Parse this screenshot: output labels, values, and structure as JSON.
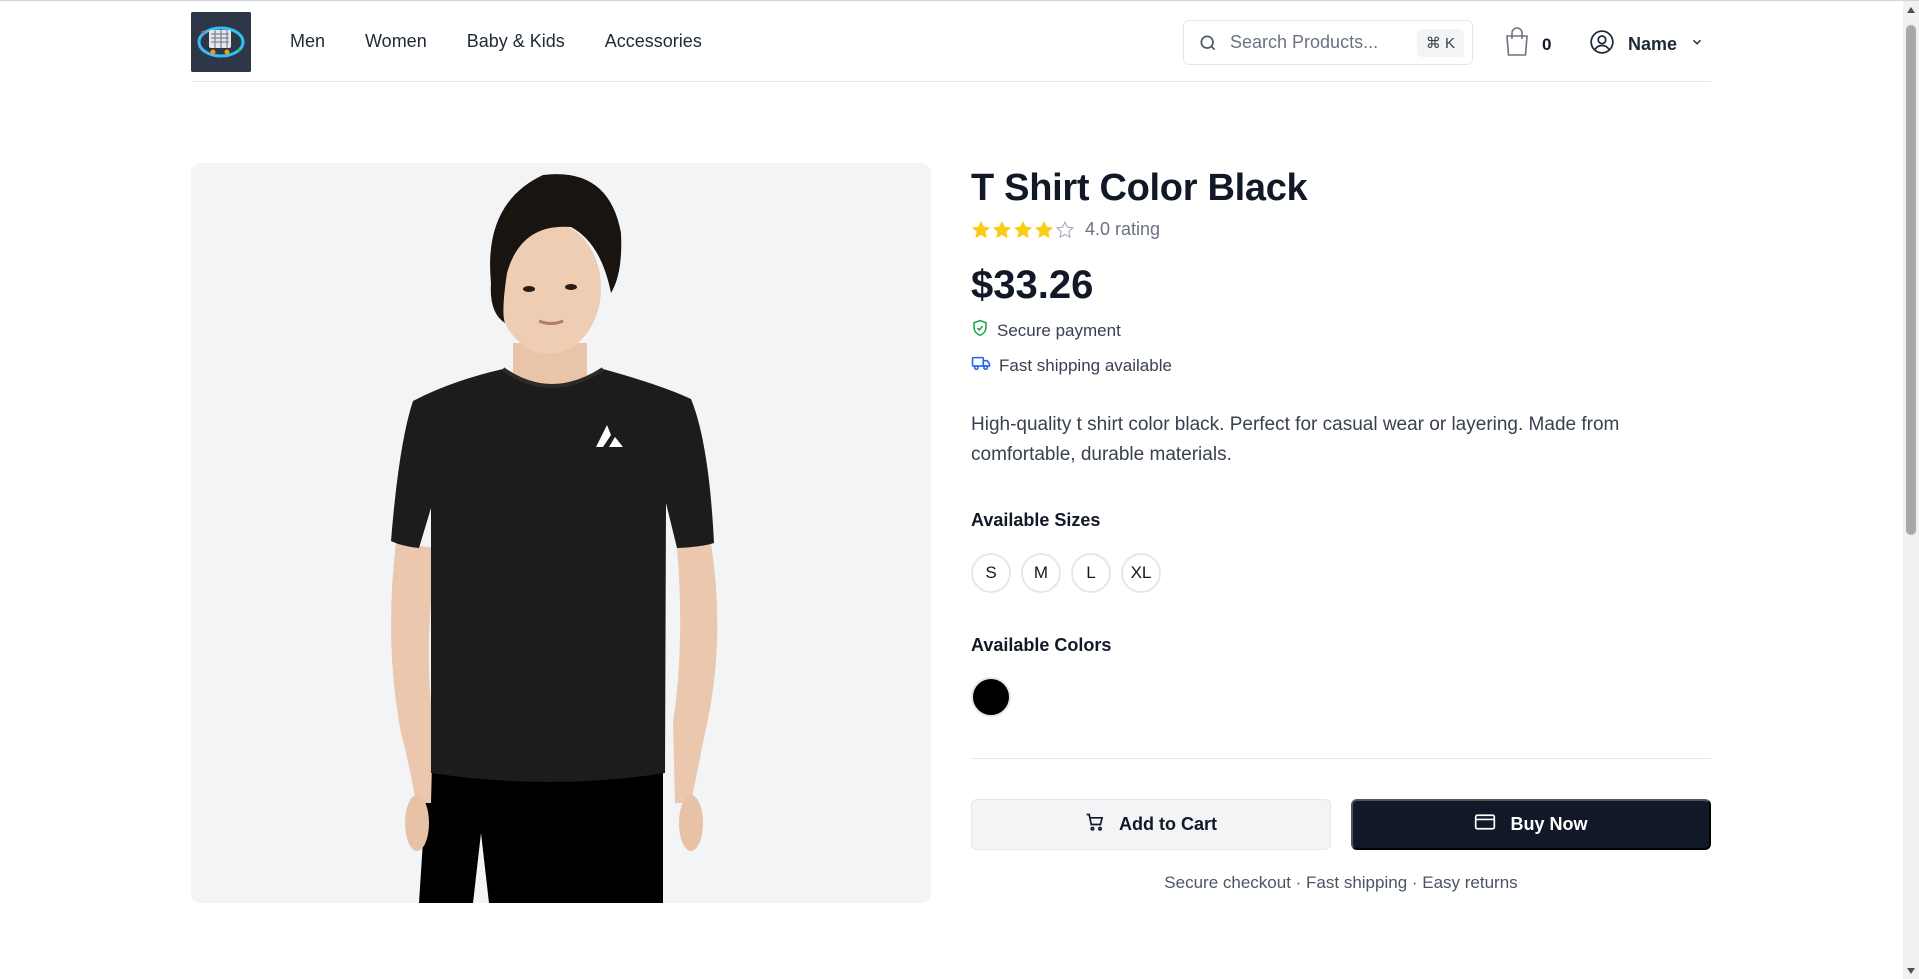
{
  "header": {
    "nav": [
      "Men",
      "Women",
      "Baby & Kids",
      "Accessories"
    ],
    "search_placeholder": "Search Products...",
    "search_shortcut": "⌘ K",
    "cart_count": "0",
    "user_name": "Name"
  },
  "product": {
    "title": "T Shirt Color Black",
    "rating": 4.0,
    "rating_max": 5,
    "rating_text": "4.0 rating",
    "price": "$33.26",
    "features": [
      "Secure payment",
      "Fast shipping available"
    ],
    "description": "High-quality t shirt color black. Perfect for casual wear or layering. Made from comfortable, durable materials.",
    "sizes_label": "Available Sizes",
    "sizes": [
      "S",
      "M",
      "L",
      "XL"
    ],
    "colors_label": "Available Colors",
    "colors": [
      "#000000"
    ],
    "add_to_cart_label": "Add to Cart",
    "buy_now_label": "Buy Now",
    "footnote": "Secure checkout · Fast shipping · Easy returns"
  },
  "colors": {
    "primary": "#111827",
    "star": "#facc15",
    "secure_green": "#16a34a",
    "shipping_blue": "#2563eb"
  }
}
